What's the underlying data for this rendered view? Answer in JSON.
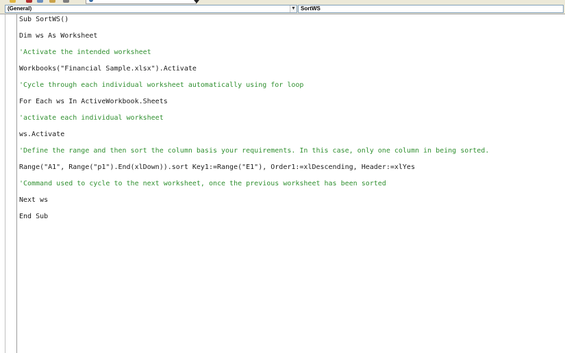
{
  "editor": {
    "object_combo": "(General)",
    "procedure_combo": "SortWS",
    "dropdown_glyph": "▼"
  },
  "code_lines": [
    {
      "text": "Sub SortWS()",
      "kind": "code"
    },
    {
      "text": "Dim ws As Worksheet",
      "kind": "code"
    },
    {
      "text": "'Activate the intended worksheet",
      "kind": "comment"
    },
    {
      "text": "Workbooks(\"Financial Sample.xlsx\").Activate",
      "kind": "code"
    },
    {
      "text": "'Cycle through each individual worksheet automatically using for loop",
      "kind": "comment"
    },
    {
      "text": "For Each ws In ActiveWorkbook.Sheets",
      "kind": "code"
    },
    {
      "text": "'activate each individual worksheet",
      "kind": "comment"
    },
    {
      "text": "ws.Activate",
      "kind": "code"
    },
    {
      "text": "'Define the range and then sort the column basis your requirements. In this case, only one column in being sorted.",
      "kind": "comment"
    },
    {
      "text": "Range(\"A1\", Range(\"p1\").End(xlDown)).sort Key1:=Range(\"E1\"), Order1:=xlDescending, Header:=xlYes",
      "kind": "code"
    },
    {
      "text": "'Command used to cycle to the next worksheet, once the previous worksheet has been sorted",
      "kind": "comment"
    },
    {
      "text": "Next ws",
      "kind": "code"
    },
    {
      "text": "End Sub",
      "kind": "code"
    }
  ],
  "colors": {
    "comment": "#2f8f2f",
    "code": "#1a1a1a",
    "chrome": "#ece9d8"
  }
}
